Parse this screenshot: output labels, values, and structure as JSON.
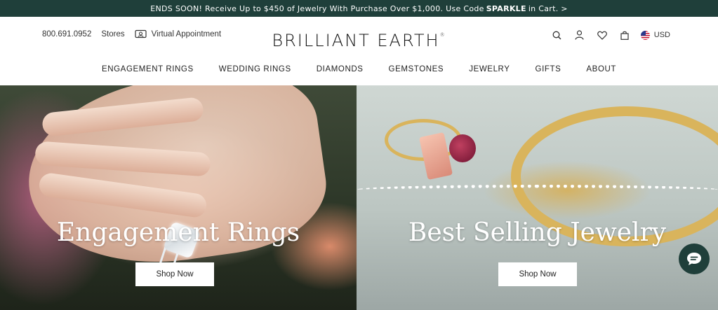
{
  "promo": {
    "text_before": "ENDS SOON! Receive Up to $450 of Jewelry With Purchase Over $1,000. Use Code",
    "code": "SPARKLE",
    "text_after": "in Cart. >"
  },
  "header": {
    "phone": "800.691.0952",
    "stores": "Stores",
    "virtual_appointment": "Virtual Appointment",
    "logo": "BRILLIANT EARTH",
    "logo_mark": "®",
    "currency": "USD"
  },
  "icons": [
    "search-icon",
    "account-icon",
    "wishlist-heart-icon",
    "shopping-bag-icon",
    "us-flag-icon",
    "video-camera-icon",
    "chat-icon"
  ],
  "nav": [
    "ENGAGEMENT RINGS",
    "WEDDING RINGS",
    "DIAMONDS",
    "GEMSTONES",
    "JEWELRY",
    "GIFTS",
    "ABOUT"
  ],
  "hero": {
    "left": {
      "title": "Engagement Rings",
      "button": "Shop Now"
    },
    "right": {
      "title": "Best Selling Jewelry",
      "button": "Shop Now"
    }
  },
  "colors": {
    "brand_dark": "#1f3f3a",
    "gold": "#d9b45c"
  }
}
